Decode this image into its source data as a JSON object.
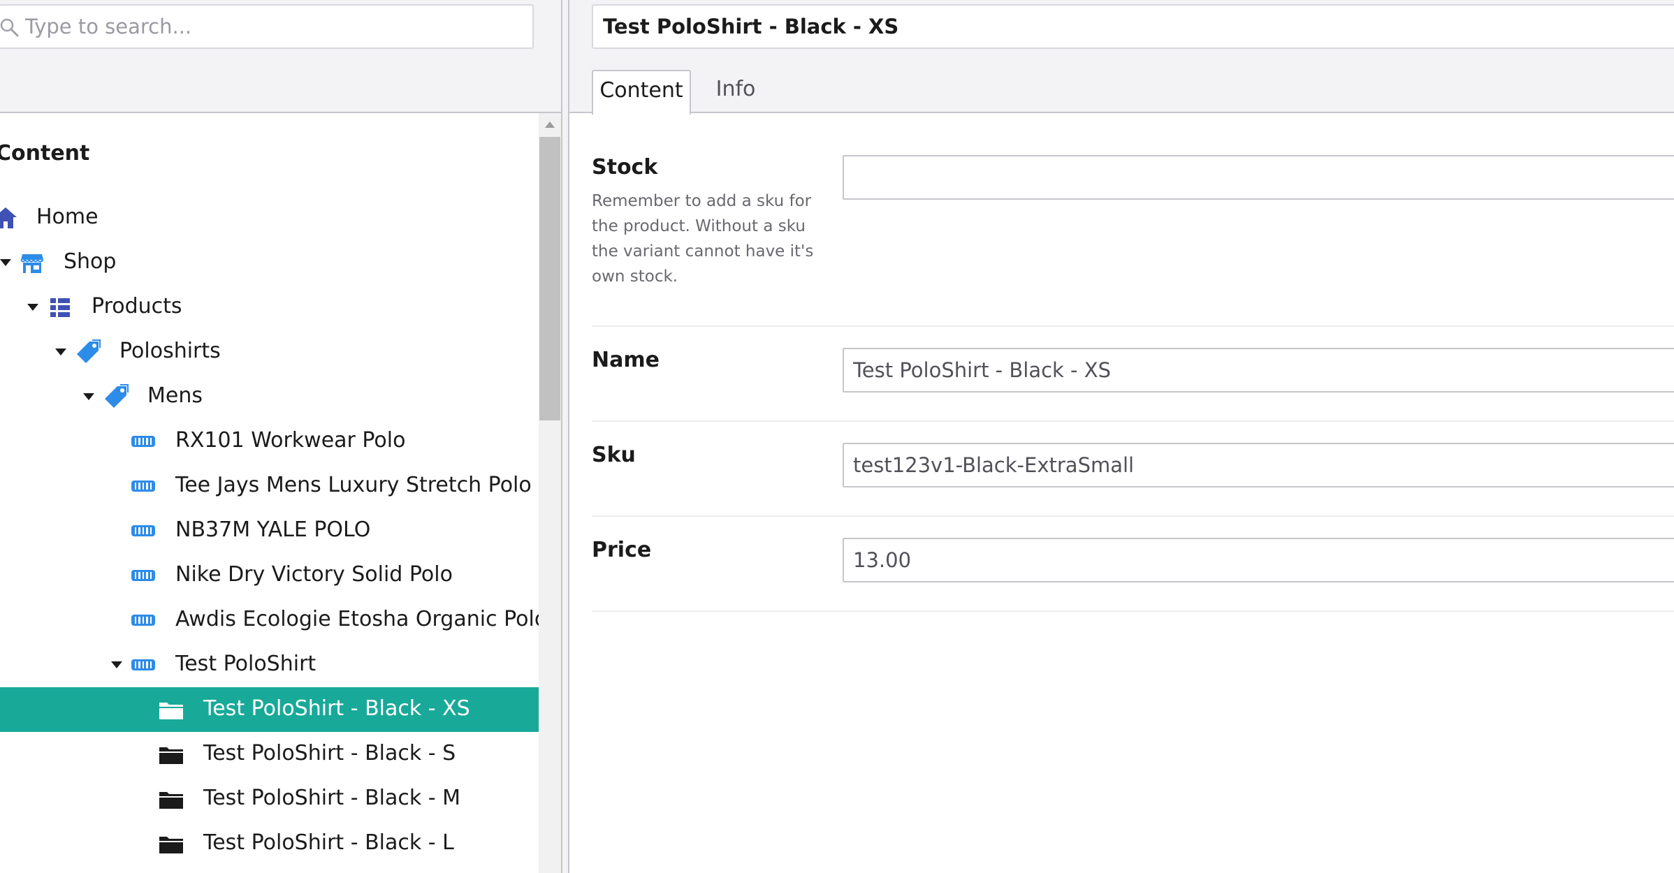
{
  "search": {
    "placeholder": "Type to search..."
  },
  "tree": {
    "title": "Content",
    "nodes": [
      {
        "label": "Home",
        "icon": "home-icon"
      },
      {
        "label": "Shop",
        "icon": "store-icon"
      },
      {
        "label": "Products",
        "icon": "list-icon"
      },
      {
        "label": "Poloshirts",
        "icon": "tag-icon"
      },
      {
        "label": "Mens",
        "icon": "tag-icon"
      },
      {
        "label": "RX101 Workwear Polo",
        "icon": "barcode-icon"
      },
      {
        "label": "Tee Jays Mens Luxury Stretch Polo",
        "icon": "barcode-icon"
      },
      {
        "label": "NB37M YALE POLO",
        "icon": "barcode-icon"
      },
      {
        "label": "Nike Dry Victory Solid Polo",
        "icon": "barcode-icon"
      },
      {
        "label": "Awdis Ecologie Etosha Organic Polo Shi",
        "icon": "barcode-icon"
      },
      {
        "label": "Test PoloShirt",
        "icon": "barcode-icon"
      },
      {
        "label": "Test PoloShirt - Black - XS",
        "icon": "folder-icon"
      },
      {
        "label": "Test PoloShirt - Black - S",
        "icon": "folder-icon"
      },
      {
        "label": "Test PoloShirt - Black - M",
        "icon": "folder-icon"
      },
      {
        "label": "Test PoloShirt - Black - L",
        "icon": "folder-icon"
      }
    ]
  },
  "editor": {
    "node_name": "Test PoloShirt - Black - XS",
    "tabs": [
      {
        "label": "Content"
      },
      {
        "label": "Info"
      }
    ],
    "properties": {
      "stock": {
        "label": "Stock",
        "description": "Remember to add a sku for the product. Without a sku the variant cannot have it's own stock.",
        "value": ""
      },
      "name": {
        "label": "Name",
        "value": "Test PoloShirt - Black - XS"
      },
      "sku": {
        "label": "Sku",
        "value": "test123v1-Black-ExtraSmall"
      },
      "price": {
        "label": "Price",
        "value": "13.00"
      }
    }
  },
  "colors": {
    "accent": "#19a999",
    "icon_blue": "#2d8ce8",
    "icon_navy": "#3f51b5",
    "panel_bg": "#f3f3f5",
    "border": "#c6c6cc"
  }
}
